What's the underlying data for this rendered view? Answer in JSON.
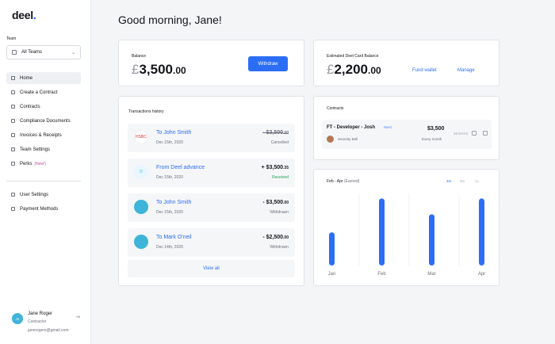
{
  "brand": {
    "name": "deel",
    "dot": "."
  },
  "sidebar": {
    "team_label": "Team",
    "team_value": "All Teams",
    "nav": [
      {
        "label": "Home",
        "icon": "home-icon",
        "active": true
      },
      {
        "label": "Create a Contract",
        "icon": "document-plus-icon"
      },
      {
        "label": "Contracts",
        "icon": "contracts-icon"
      },
      {
        "label": "Compliance Documents",
        "icon": "compliance-icon"
      },
      {
        "label": "Invoices & Receipts",
        "icon": "invoice-icon"
      },
      {
        "label": "Team Settings",
        "icon": "team-settings-icon"
      },
      {
        "label": "Perks",
        "icon": "perks-icon",
        "badge": "(New!)"
      }
    ],
    "nav_secondary": [
      {
        "label": "User Settings",
        "icon": "user-icon"
      },
      {
        "label": "Payment Methods",
        "icon": "payment-methods-icon"
      }
    ],
    "user": {
      "initials": "JR",
      "name": "Jane Roger",
      "role": "Contractor",
      "email": "janerogers@gmail.com"
    }
  },
  "greeting": "Good morning, Jane!",
  "balance": {
    "label": "Balance",
    "currency": "£",
    "whole": "3,500",
    "decimals": ".00",
    "button": "Withdraw"
  },
  "deel_card": {
    "label": "Estimated Deel Card Balance",
    "currency": "£",
    "whole": "2,200",
    "decimals": ".00",
    "fund_link": "Fund wallet",
    "manage_link": "Manage"
  },
  "transactions": {
    "title": "Transactions history",
    "items": [
      {
        "title": "To John Smith",
        "date": "Dec 15th, 2020",
        "amount": "- $3,500",
        "decimals": ".00",
        "status": "Cancelled",
        "icon": "hsbc-bank-icon",
        "icon_text": "HSBC",
        "icon_bg": "#ffffff",
        "strike": true,
        "positive": false
      },
      {
        "title": "From Deel advance",
        "date": "Dec 15th, 2020",
        "amount": "+ $3,500",
        "decimals": ".35",
        "status": "Received",
        "icon": "deel-advance-icon",
        "icon_text": "D",
        "icon_bg": "#e8f7ff",
        "strike": false,
        "positive": true
      },
      {
        "title": "To John Smith",
        "date": "Dec 15th, 2020",
        "amount": "- $3,500",
        "decimals": ".00",
        "status": "Withdrawn",
        "icon": "bank-transfer-icon",
        "icon_text": "",
        "icon_bg": "#3fb4d9",
        "strike": false,
        "positive": false
      },
      {
        "title": "To Mark O'neil",
        "date": "Dec 14th, 2020",
        "amount": "- $2,500",
        "decimals": ".00",
        "status": "Withdrawn",
        "icon": "bank-transfer-icon",
        "icon_text": "",
        "icon_bg": "#3fb4d9",
        "strike": false,
        "positive": false
      }
    ],
    "view_all": "View all"
  },
  "contracts": {
    "title": "Contracts",
    "items": [
      {
        "title": "FT - Developer - Josh",
        "badge": "PAYG",
        "person": "Serenity Bell",
        "amount": "$3,500",
        "period": "Every month",
        "days": "15 DAYS"
      }
    ]
  },
  "earnings_chart": {
    "title": "Feb - Apr",
    "subtitle": "(Earned)",
    "ranges": [
      "3m",
      "6m",
      "1y"
    ],
    "active_range": "3m",
    "accent": "#2b6ef5"
  },
  "chart_data": {
    "type": "bar",
    "categories": [
      "Jan",
      "Feb",
      "Mar",
      "Apr"
    ],
    "values": [
      46,
      93,
      71,
      93
    ],
    "ylim": [
      0,
      100
    ],
    "grid": true,
    "title": "Feb - Apr (Earned)"
  }
}
